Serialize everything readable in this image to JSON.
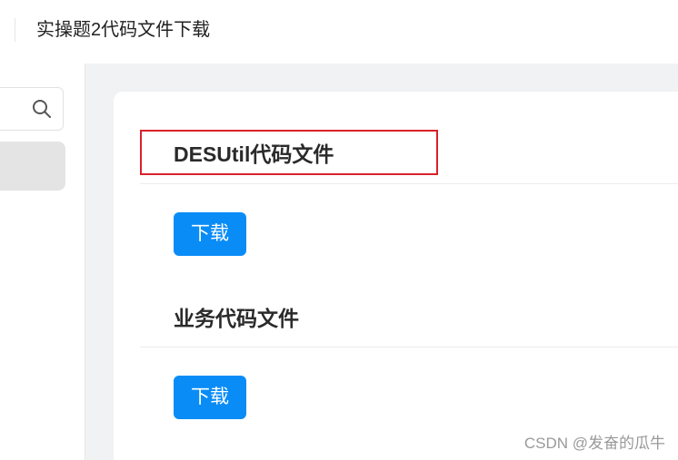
{
  "header": {
    "title": "实操题2代码文件下载"
  },
  "sidebar": {
    "search_icon": "search-icon"
  },
  "sections": [
    {
      "title": "DESUtil代码文件",
      "button_label": "下载",
      "highlighted": true
    },
    {
      "title": "业务代码文件",
      "button_label": "下载",
      "highlighted": false
    }
  ],
  "watermark": "CSDN @发奋的瓜牛",
  "colors": {
    "accent": "#0a8cf7",
    "highlight_border": "#d9212b",
    "background": "#f1f2f4"
  }
}
